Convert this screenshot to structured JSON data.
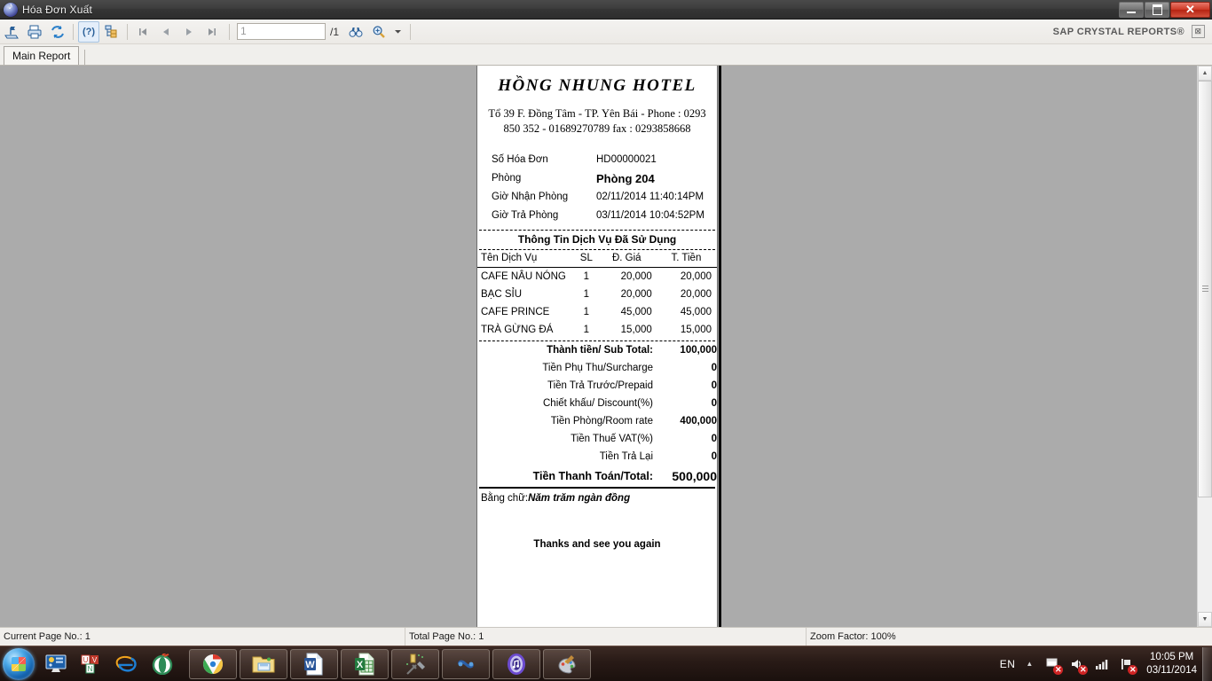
{
  "window": {
    "title": "Hóa Đơn Xuất",
    "icon": "media-note-icon",
    "minimize_label": "",
    "maximize_label": "",
    "close_label": "✕"
  },
  "toolbar": {
    "export_label": "",
    "print_label": "",
    "refresh_label": "",
    "help_label": "(?)",
    "group_tree_label": "",
    "first_page_label": "",
    "prev_page_label": "",
    "next_page_label": "",
    "last_page_label": "",
    "page_value": "1",
    "page_placeholder": "1",
    "page_total": "/1",
    "find_label": "",
    "zoom_label": "",
    "zoom_dropdown_label": "",
    "brand": "SAP CRYSTAL REPORTS®",
    "brand_close": "⊠"
  },
  "tabs": [
    {
      "label": "Main Report"
    }
  ],
  "report": {
    "hotel_name": "HỒNG NHUNG HOTEL",
    "address_line1": "Tổ 39 F. Đồng Tâm - TP. Yên Bái - Phone :  0293",
    "address_line2": "850 352 - 01689270789 fax : 0293858668",
    "info": [
      {
        "label": "Số Hóa Đơn",
        "value": "HD00000021",
        "bold": false
      },
      {
        "label": "Phòng",
        "value": "Phòng 204",
        "bold": true
      },
      {
        "label": "Giờ Nhận Phòng",
        "value": "02/11/2014  11:40:14PM",
        "bold": false
      },
      {
        "label": "Giờ Trả Phòng",
        "value": "03/11/2014  10:04:52PM",
        "bold": false
      }
    ],
    "services_title": "Thông Tin Dịch Vụ Đã Sử Dụng",
    "services_headers": [
      "Tên Dịch Vụ",
      "SL",
      "Đ. Giá",
      "T. Tiền"
    ],
    "services": [
      {
        "name": "CAFE NÂU NÓNG",
        "qty": "1",
        "unit_price": "20,000",
        "amount": "20,000"
      },
      {
        "name": "BẠC SỈU",
        "qty": "1",
        "unit_price": "20,000",
        "amount": "20,000"
      },
      {
        "name": "CAFE PRINCE",
        "qty": "1",
        "unit_price": "45,000",
        "amount": "45,000"
      },
      {
        "name": "TRÀ GỪNG ĐÁ",
        "qty": "1",
        "unit_price": "15,000",
        "amount": "15,000"
      }
    ],
    "totals": [
      {
        "label": "Thành tiền/ Sub Total:",
        "value": "100,000",
        "strong": true,
        "grand": false
      },
      {
        "label": "Tiền Phụ Thu/Surcharge",
        "value": "0",
        "strong": false,
        "grand": false
      },
      {
        "label": "Tiền Trả Trước/Prepaid",
        "value": "0",
        "strong": false,
        "grand": false
      },
      {
        "label": "Chiết khấu/ Discount(%)",
        "value": "0",
        "strong": false,
        "grand": false
      },
      {
        "label": "Tiền Phòng/Room rate",
        "value": "400,000",
        "strong": false,
        "grand": false
      },
      {
        "label": "Tiền Thuế VAT(%)",
        "value": "0",
        "strong": false,
        "grand": false
      },
      {
        "label": "Tiền Trả Lại",
        "value": "0",
        "strong": false,
        "grand": false
      },
      {
        "label": "Tiền Thanh Toán/Total:",
        "value": "500,000",
        "strong": true,
        "grand": true
      }
    ],
    "words_label": "Bằng chữ:",
    "words_value": "Năm trăm ngàn đồng",
    "thanks": "Thanks and see you again"
  },
  "statusbar": {
    "current_page": "Current Page No.: 1",
    "total_page": "Total Page No.: 1",
    "zoom_factor": "Zoom Factor: 100%"
  },
  "taskbar": {
    "start_label": "",
    "quick_launch": [
      {
        "name": "display-settings-icon"
      },
      {
        "name": "unikey-icon"
      },
      {
        "name": "internet-explorer-icon"
      },
      {
        "name": "opera-icon"
      }
    ],
    "tasks": [
      {
        "name": "google-chrome-icon"
      },
      {
        "name": "file-explorer-icon"
      },
      {
        "name": "microsoft-word-icon"
      },
      {
        "name": "microsoft-excel-icon"
      },
      {
        "name": "visual-studio-icon"
      },
      {
        "name": "sql-server-icon"
      },
      {
        "name": "itunes-icon"
      },
      {
        "name": "paint-icon"
      }
    ],
    "tray": {
      "language": "EN",
      "show_hidden": "▲",
      "icons": [
        {
          "name": "action-center-icon",
          "badge": "✕"
        },
        {
          "name": "volume-muted-icon",
          "badge": "✕"
        },
        {
          "name": "signal-bars-icon",
          "badge": ""
        },
        {
          "name": "network-error-icon",
          "badge": "✕"
        }
      ],
      "time": "10:05 PM",
      "date": "03/11/2014"
    }
  },
  "colors": {
    "preview_background": "#ababab",
    "paper": "#ffffff",
    "accent_blue": "#2a6099",
    "close_red": "#cf3a27"
  }
}
